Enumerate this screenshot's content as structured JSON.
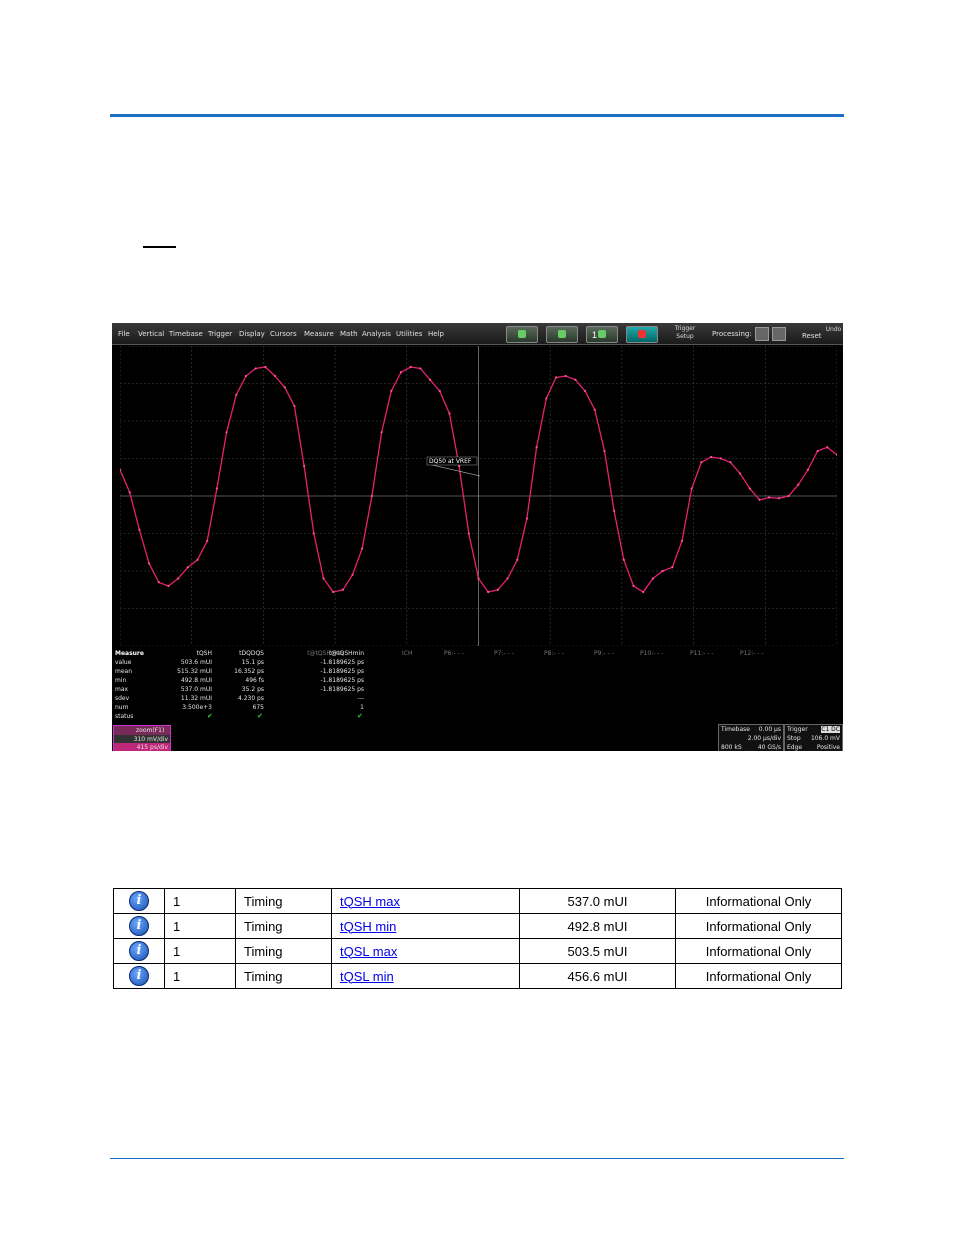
{
  "scope": {
    "menu": [
      "File",
      "Vertical",
      "Timebase",
      "Trigger",
      "Display",
      "Cursors",
      "Measure",
      "Math",
      "Analysis",
      "Utilities",
      "Help"
    ],
    "trigger_setup": "Trigger\nSetup",
    "processing": "Processing:",
    "reset": "Reset",
    "undo": "Undo",
    "toolbar_num": "1",
    "annotation": "DQ50 at VREF",
    "measure": {
      "row_labels": [
        "Measure",
        "value",
        "mean",
        "min",
        "max",
        "sdev",
        "num",
        "status"
      ],
      "columns": [
        {
          "name": "tQSH",
          "values": [
            "503.6 mUI",
            "515.32 mUI",
            "492.8 mUI",
            "537.0 mUI",
            "11.32 mUI",
            "3.500e+3"
          ]
        },
        {
          "name": "tDQDQS",
          "values": [
            "15.1 ps",
            "16.352 ps",
            "496 fs",
            "35.2 ps",
            "4.230 ps",
            "675"
          ]
        },
        {
          "name": "t@tQSHmax",
          "values": []
        },
        {
          "name": "t@tQSHmin",
          "values": [
            "-1.8189625 ps",
            "-1.8189625 ps",
            "-1.8189625 ps",
            "-1.8189625 ps",
            "---",
            "1"
          ]
        }
      ],
      "extra_cols": [
        "ICH",
        "P6:- - -",
        "P7:- - -",
        "P8:- - -",
        "P9:- - -",
        "P10:- - -",
        "P11:- - -",
        "P12:- - -"
      ]
    },
    "zoom": {
      "label": "zoom(F1)",
      "vdiv": "310 mV/div",
      "tdiv": "415 ps/div"
    },
    "timebase": {
      "label": "Timebase",
      "delay": "0.00 µs",
      "tdiv": "2.00 µs/div",
      "samples": "800 kS",
      "rate": "40 GS/s"
    },
    "trigger": {
      "label": "Trigger",
      "tag": "C1 DC",
      "mode": "Stop",
      "level": "106.0 mV",
      "type": "Edge",
      "slope": "Positive"
    },
    "waveform": [
      0.35,
      0.05,
      -0.45,
      -0.9,
      -1.15,
      -1.2,
      -1.1,
      -0.95,
      -0.85,
      -0.6,
      0.1,
      0.85,
      1.35,
      1.6,
      1.7,
      1.72,
      1.6,
      1.45,
      1.2,
      0.4,
      -0.5,
      -1.1,
      -1.28,
      -1.25,
      -1.05,
      -0.7,
      0.0,
      0.85,
      1.4,
      1.65,
      1.72,
      1.7,
      1.55,
      1.4,
      1.1,
      0.4,
      -0.5,
      -1.1,
      -1.28,
      -1.25,
      -1.1,
      -0.85,
      -0.3,
      0.65,
      1.3,
      1.58,
      1.6,
      1.55,
      1.4,
      1.15,
      0.6,
      -0.2,
      -0.85,
      -1.2,
      -1.28,
      -1.1,
      -1.0,
      -0.95,
      -0.6,
      0.1,
      0.45,
      0.52,
      0.5,
      0.45,
      0.3,
      0.1,
      -0.05,
      -0.02,
      -0.03,
      0.0,
      0.15,
      0.35,
      0.6,
      0.65,
      0.55
    ]
  },
  "table": {
    "rows": [
      {
        "icon": "i",
        "num": "1",
        "cat": "Timing",
        "name": "tQSH max",
        "value": "537.0 mUI",
        "status": "Informational Only"
      },
      {
        "icon": "i",
        "num": "1",
        "cat": "Timing",
        "name": "tQSH min",
        "value": "492.8 mUI",
        "status": "Informational Only"
      },
      {
        "icon": "i",
        "num": "1",
        "cat": "Timing",
        "name": "tQSL max",
        "value": "503.5 mUI",
        "status": "Informational Only"
      },
      {
        "icon": "i",
        "num": "1",
        "cat": "Timing",
        "name": "tQSL min",
        "value": "456.6 mUI",
        "status": "Informational Only"
      }
    ]
  }
}
